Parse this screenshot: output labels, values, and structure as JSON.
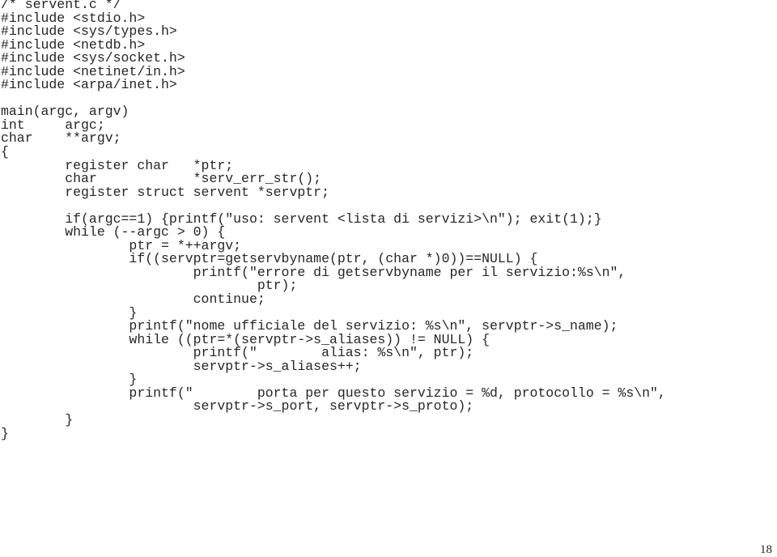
{
  "document": {
    "file_comment": "/* servent.c */",
    "code_lines": [
      "/* servent.c */",
      "#include <stdio.h>",
      "#include <sys/types.h>",
      "#include <netdb.h>",
      "#include <sys/socket.h>",
      "#include <netinet/in.h>",
      "#include <arpa/inet.h>",
      "",
      "main(argc, argv)",
      "int     argc;",
      "char    **argv;",
      "{",
      "        register char   *ptr;",
      "        char            *serv_err_str();",
      "        register struct servent *servptr;",
      "",
      "        if(argc==1) {printf(\"uso: servent <lista di servizi>\\n\"); exit(1);}",
      "        while (--argc > 0) {",
      "                ptr = *++argv;",
      "                if((servptr=getservbyname(ptr, (char *)0))==NULL) {",
      "                        printf(\"errore di getservbyname per il servizio:%s\\n\",",
      "                                ptr);",
      "                        continue;",
      "                }",
      "                printf(\"nome ufficiale del servizio: %s\\n\", servptr->s_name);",
      "                while ((ptr=*(servptr->s_aliases)) != NULL) {",
      "                        printf(\"        alias: %s\\n\", ptr);",
      "                        servptr->s_aliases++;",
      "                }",
      "                printf(\"        porta per questo servizio = %d, protocollo = %s\\n\",",
      "                        servptr->s_port, servptr->s_proto);",
      "        }",
      "}"
    ],
    "page_number": "18"
  }
}
